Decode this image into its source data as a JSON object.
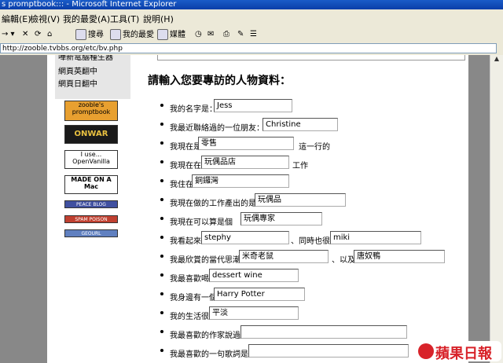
{
  "window": {
    "title": "s promptbook:::  - Microsoft Internet Explorer"
  },
  "menu": [
    "編輯(E)",
    "檢視(V)",
    "我的最愛(A)",
    "工具(T)",
    "說明(H)"
  ],
  "toolbar": {
    "search": "搜尋",
    "favorites": "我的最愛",
    "media": "媒體"
  },
  "address": {
    "url": "http://zooble.tvbbs.org/etc/bv.php"
  },
  "sidebar": {
    "items": [
      "嘩新電腦種生器",
      "網頁英翻中",
      "網頁日翻中"
    ]
  },
  "badges": [
    {
      "label": "zooble's promptbook",
      "bg": "#e8a030",
      "fg": "#000000"
    },
    {
      "label": "ONWAR",
      "bg": "#1a1a1a",
      "fg": "#e8c040"
    },
    {
      "label": "I use... OpenVanilla",
      "bg": "#ffffff",
      "fg": "#000000"
    },
    {
      "label": "MADE ON A Mac",
      "bg": "#ffffff",
      "fg": "#000000"
    },
    {
      "label": "PEACE BLOG",
      "bg": "#4050a0",
      "fg": "#ffffff"
    },
    {
      "label": "SPAM POISON",
      "bg": "#c04030",
      "fg": "#ffffff"
    },
    {
      "label": "GEOURL",
      "bg": "#6080c0",
      "fg": "#ffffff"
    }
  ],
  "form": {
    "heading": "請輸入您要專訪的人物資料：",
    "rows": [
      {
        "parts": [
          "我的名字是："
        ],
        "values": [
          "Jess"
        ]
      },
      {
        "parts": [
          "我最近聯絡過的一位朋友："
        ],
        "values": [
          "Christine"
        ]
      },
      {
        "parts": [
          "我現在是幹",
          "這一行的"
        ],
        "values": [
          "零售"
        ]
      },
      {
        "parts": [
          "我現在在",
          "工作"
        ],
        "values": [
          "玩偶品店"
        ]
      },
      {
        "parts": [
          "我住在"
        ],
        "values": [
          "銅鑼灣"
        ]
      },
      {
        "parts": [
          "我現在做的工作產出的是"
        ],
        "values": [
          "玩偶品"
        ]
      },
      {
        "parts": [
          "我現在可以算是個"
        ],
        "values": [
          "玩偶專家"
        ]
      },
      {
        "parts": [
          "我看起來",
          "、同時也很"
        ],
        "values": [
          "stephy",
          "miki"
        ]
      },
      {
        "parts": [
          "我最欣賞的當代思潮",
          "、以及"
        ],
        "values": [
          "米奇老鼠",
          "唐奴鴨"
        ]
      },
      {
        "parts": [
          "我最喜歡喝"
        ],
        "values": [
          "dessert wine"
        ]
      },
      {
        "parts": [
          "我身邊有一個"
        ],
        "values": [
          "Harry Potter"
        ]
      },
      {
        "parts": [
          "我的生活很"
        ],
        "values": [
          "平淡"
        ]
      },
      {
        "parts": [
          "我最喜歡的作家說過"
        ],
        "values": [
          ""
        ]
      },
      {
        "parts": [
          "我最喜歡的一句歌詞是"
        ],
        "values": [
          ""
        ]
      }
    ]
  },
  "logo": {
    "text": "蘋果日報"
  }
}
